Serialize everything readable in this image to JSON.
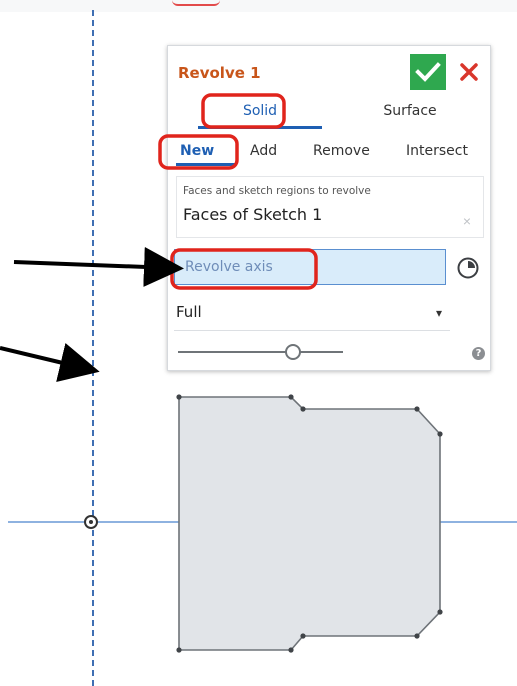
{
  "panel": {
    "title": "Revolve 1",
    "ok_icon": "checkmark-icon",
    "close_icon": "close-icon",
    "tabs": [
      {
        "label": "Solid",
        "selected": true
      },
      {
        "label": "Surface",
        "selected": false
      }
    ],
    "operations": [
      {
        "label": "New",
        "selected": true
      },
      {
        "label": "Add",
        "selected": false
      },
      {
        "label": "Remove",
        "selected": false
      },
      {
        "label": "Intersect",
        "selected": false
      }
    ],
    "faces": {
      "label": "Faces and sketch regions to revolve",
      "value": "Faces of Sketch 1",
      "clear_glyph": "×"
    },
    "axis_field": {
      "placeholder": "Revolve axis",
      "value": ""
    },
    "clock_icon": "clock-icon",
    "revolve_type": {
      "value": "Full",
      "caret": "▾"
    },
    "slider_level": 0.7,
    "help_glyph": "?"
  },
  "colors": {
    "accent_blue": "#1e5fb3",
    "title_orange": "#c8551a",
    "ok_green": "#2fa84f",
    "close_red": "#d9362b",
    "highlight_red": "#e0241c",
    "annotation_arrow": "#000000",
    "sketch_fill": "#e1e4e8",
    "sketch_edge": "#6e7378",
    "axis_blue": "#3f6fb3"
  },
  "annotations": {
    "highlight_boxes": [
      "tab-solid",
      "op-new",
      "axis-field"
    ],
    "arrows": [
      "pointing-to-revolve-axis-field",
      "pointing-to-vertical-sketch-axis"
    ]
  }
}
